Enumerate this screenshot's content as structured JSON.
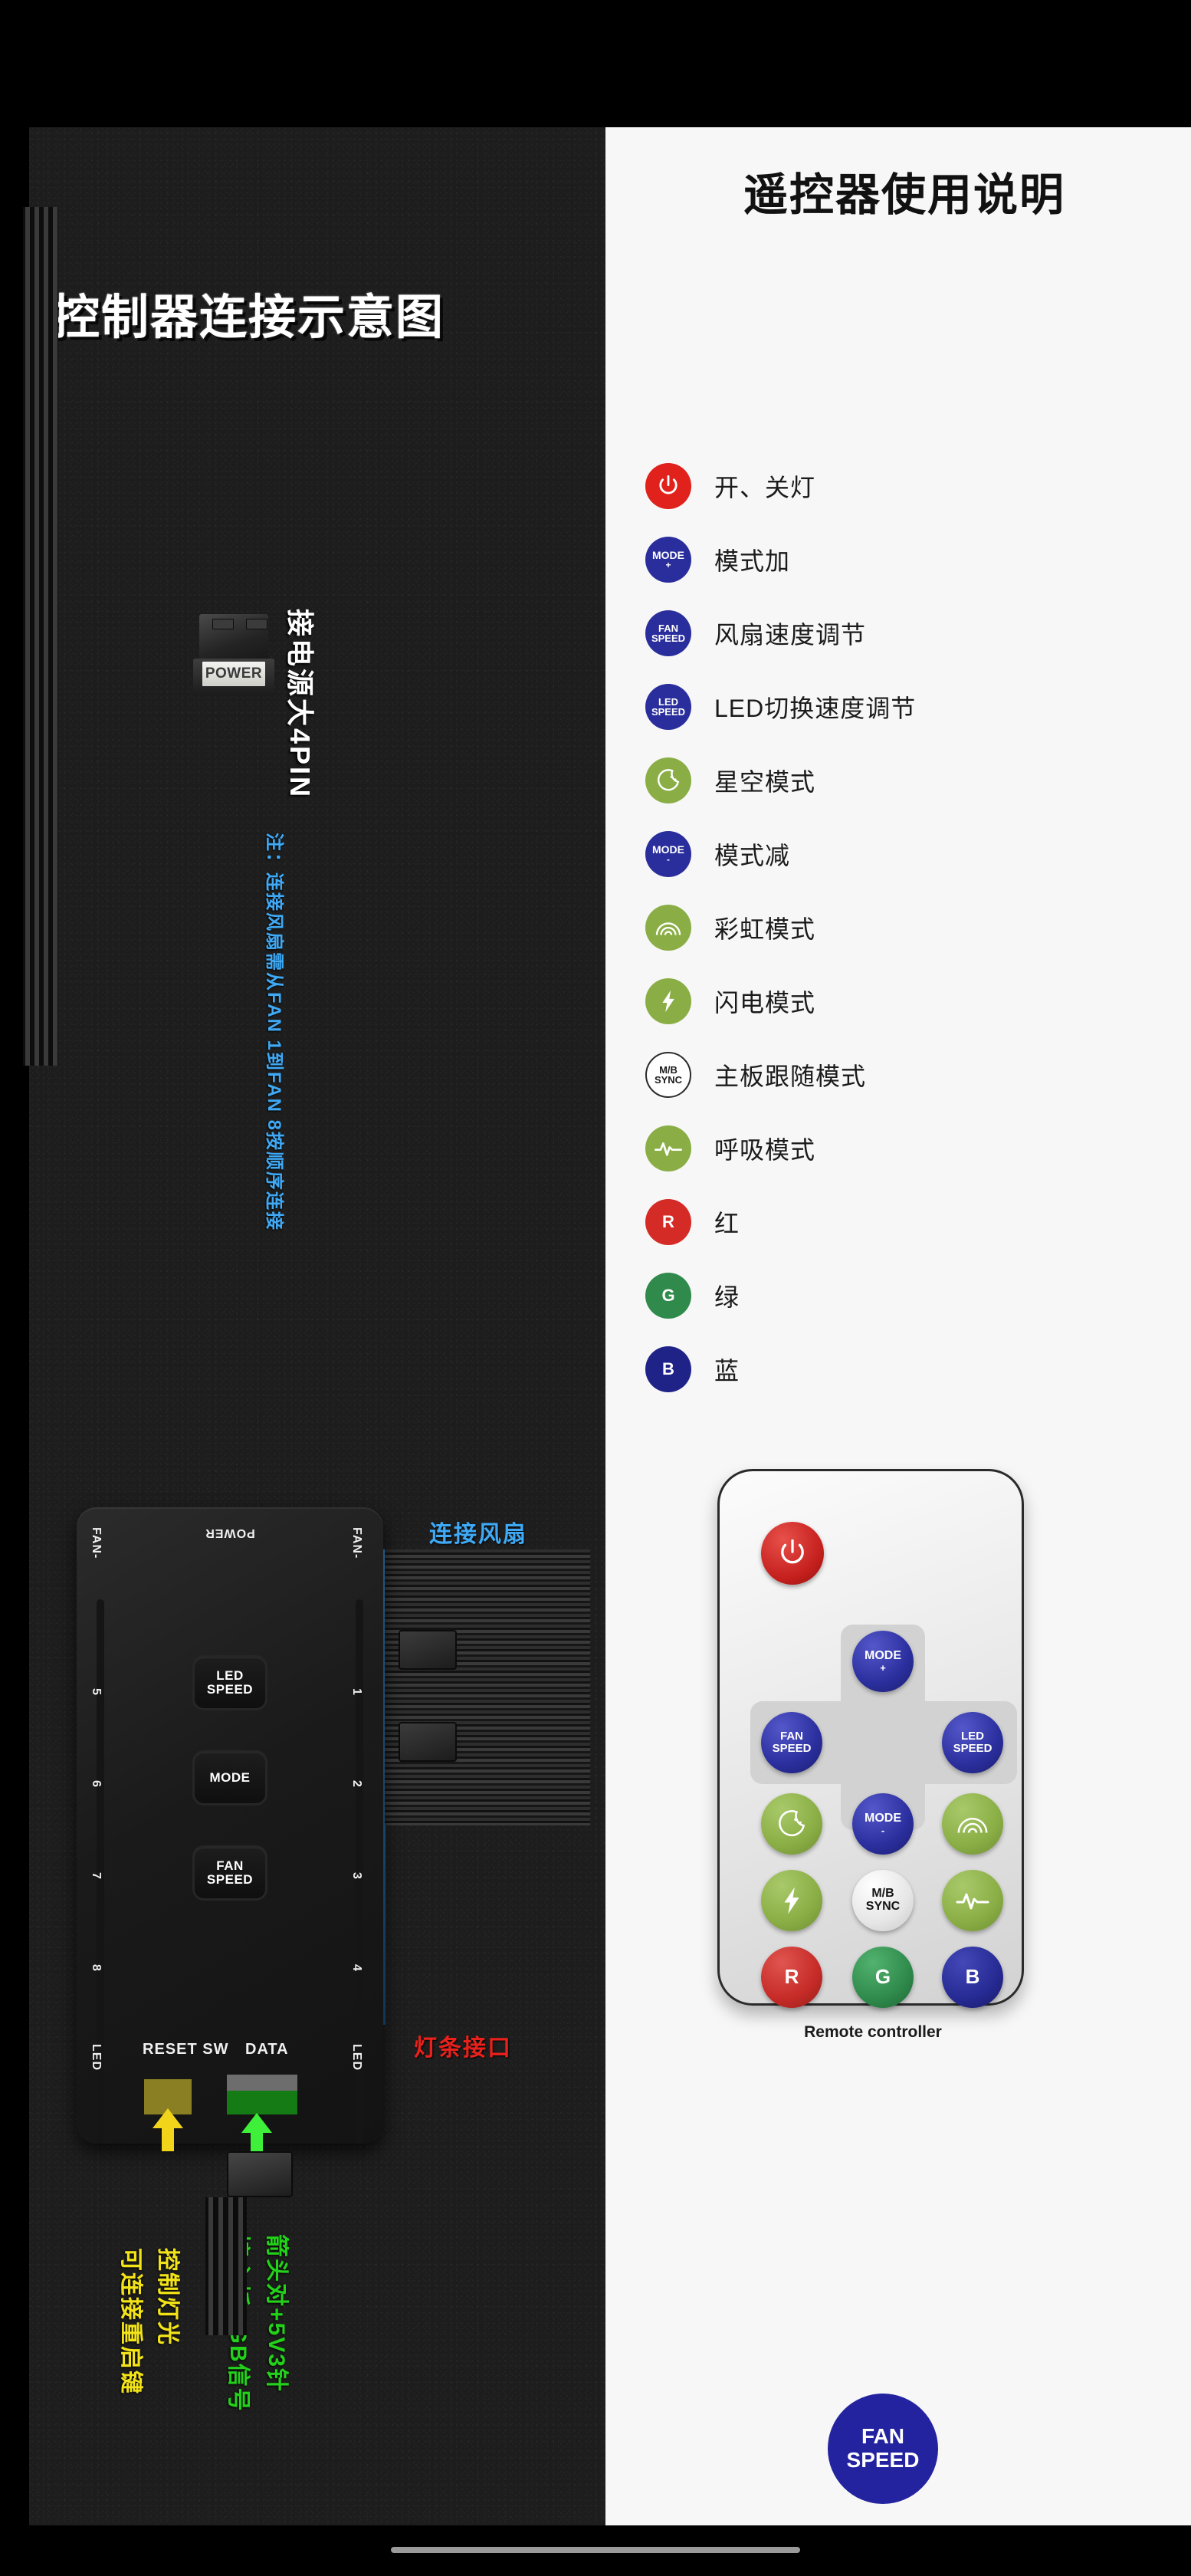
{
  "left_panel": {
    "title": "控制器连接示意图",
    "power_connector_label": "POWER",
    "power_source_label": "接电源大4PIN",
    "note_blue": "注：连接风扇需从FAN 1到FAN 8按顺序连接",
    "fan_connect_label": "连接风扇",
    "strip_port_label": "灯条接口",
    "reset_label_1": "可连接重启键",
    "reset_label_2": "控制灯光",
    "rgb_label_1": "接主板RGB信号",
    "rgb_label_2": "箭头对+5V3针",
    "board": {
      "top_center": "POWER",
      "fan_minus_left": "FAN-",
      "fan_minus_right": "FAN-",
      "led_left": "LED",
      "led_right": "LED",
      "left_ports": [
        "5",
        "6",
        "7",
        "8"
      ],
      "right_ports": [
        "1",
        "2",
        "3",
        "4"
      ],
      "keys": [
        "LED SPEED",
        "MODE",
        "FAN SPEED"
      ],
      "key_lines": [
        [
          "LED",
          "SPEED"
        ],
        [
          "MODE",
          ""
        ],
        [
          "FAN",
          "SPEED"
        ]
      ],
      "reset_sw": "RESET SW",
      "data": "DATA"
    }
  },
  "right_panel": {
    "title": "遥控器使用说明",
    "legend": [
      {
        "icon": "power-icon",
        "badge_text": "",
        "badge_lines": [],
        "color": "#e0211c",
        "label": "开、关灯"
      },
      {
        "icon": "mode-plus-icon",
        "badge_text": "MODE +",
        "badge_lines": [
          "MODE",
          "+"
        ],
        "color": "#2a2e9c",
        "label": "模式加"
      },
      {
        "icon": "fan-speed-icon",
        "badge_text": "FAN SPEED",
        "badge_lines": [
          "FAN",
          "SPEED"
        ],
        "color": "#2a2e9c",
        "label": "风扇速度调节"
      },
      {
        "icon": "led-speed-icon",
        "badge_text": "LED SPEED",
        "badge_lines": [
          "LED",
          "SPEED"
        ],
        "color": "#2a2e9c",
        "label": "LED切换速度调节"
      },
      {
        "icon": "moon-stars-icon",
        "badge_text": "",
        "badge_lines": [],
        "color": "#8aae45",
        "label": "星空模式"
      },
      {
        "icon": "mode-minus-icon",
        "badge_text": "MODE -",
        "badge_lines": [
          "MODE",
          "-"
        ],
        "color": "#2a2e9c",
        "label": "模式减"
      },
      {
        "icon": "rainbow-icon",
        "badge_text": "",
        "badge_lines": [],
        "color": "#8aae45",
        "label": "彩虹模式"
      },
      {
        "icon": "lightning-icon",
        "badge_text": "",
        "badge_lines": [],
        "color": "#8aae45",
        "label": "闪电模式"
      },
      {
        "icon": "mb-sync-icon",
        "badge_text": "M/B SYNC",
        "badge_lines": [
          "M/B",
          "SYNC"
        ],
        "color": "#ffffff",
        "label": "主板跟随模式"
      },
      {
        "icon": "pulse-icon",
        "badge_text": "",
        "badge_lines": [],
        "color": "#8aae45",
        "label": "呼吸模式"
      },
      {
        "icon": "r-icon",
        "badge_text": "R",
        "badge_lines": [
          "R"
        ],
        "color": "#d52b26",
        "label": "红"
      },
      {
        "icon": "g-icon",
        "badge_text": "G",
        "badge_lines": [
          "G"
        ],
        "color": "#2f8a4b",
        "label": "绿"
      },
      {
        "icon": "b-icon",
        "badge_text": "B",
        "badge_lines": [
          "B"
        ],
        "color": "#1f2388",
        "label": "蓝"
      }
    ],
    "remote": {
      "caption": "Remote controller",
      "buttons": {
        "power": "",
        "mode_plus_l1": "MODE",
        "mode_plus_l2": "+",
        "fan_speed_l1": "FAN",
        "fan_speed_l2": "SPEED",
        "led_speed_l1": "LED",
        "led_speed_l2": "SPEED",
        "mode_minus_l1": "MODE",
        "mode_minus_l2": "-",
        "mb_sync_l1": "M/B",
        "mb_sync_l2": "SYNC",
        "r": "R",
        "g": "G",
        "b": "B"
      }
    },
    "floating_button": {
      "line1": "FAN",
      "line2": "SPEED"
    }
  },
  "colors": {
    "blue": "#2a2e9c",
    "red": "#e0211c",
    "green": "#8aae45",
    "note_blue": "#3fa9f5",
    "yellow": "#f2e318",
    "bright_green": "#23d11a"
  }
}
